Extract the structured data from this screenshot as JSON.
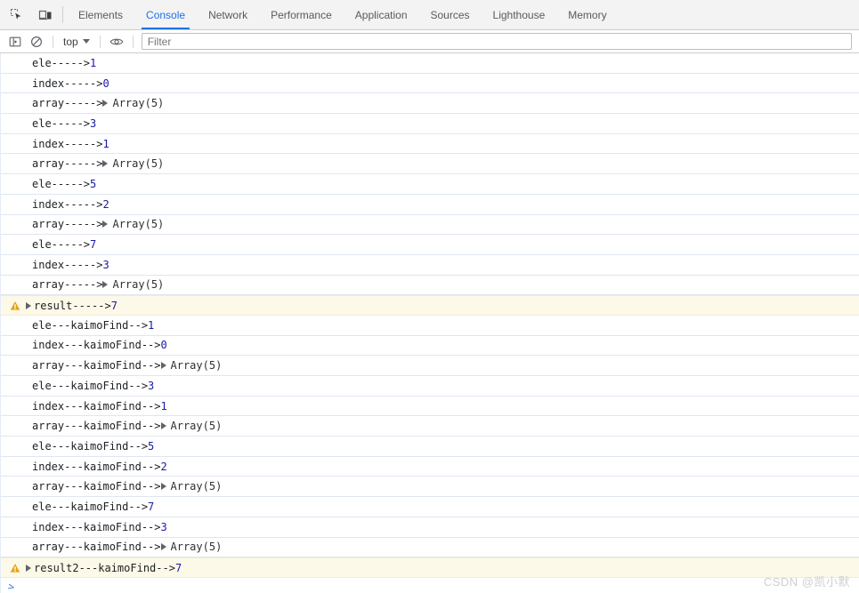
{
  "devtools": {
    "toolbar_icons": [
      {
        "name": "inspect-element-icon",
        "title": "Inspect element"
      },
      {
        "name": "device-toolbar-icon",
        "title": "Toggle device toolbar"
      }
    ],
    "tabs": [
      {
        "label": "Elements",
        "active": false
      },
      {
        "label": "Console",
        "active": true
      },
      {
        "label": "Network",
        "active": false
      },
      {
        "label": "Performance",
        "active": false
      },
      {
        "label": "Application",
        "active": false
      },
      {
        "label": "Sources",
        "active": false
      },
      {
        "label": "Lighthouse",
        "active": false
      },
      {
        "label": "Memory",
        "active": false
      }
    ]
  },
  "console_toolbar": {
    "sidebar_toggle": "show-console-sidebar-icon",
    "clear_console": "clear-console-icon",
    "context_selector": "top",
    "eye_icon": "live-expression-eye-icon",
    "filter_placeholder": "Filter",
    "filter_value": ""
  },
  "messages": [
    {
      "level": "log",
      "label": "ele----->",
      "value": "1",
      "type": "number"
    },
    {
      "level": "log",
      "label": "index----->",
      "value": "0",
      "type": "number"
    },
    {
      "level": "log",
      "label": "array----->",
      "value": "Array(5)",
      "type": "object"
    },
    {
      "level": "log",
      "label": "ele----->",
      "value": "3",
      "type": "number"
    },
    {
      "level": "log",
      "label": "index----->",
      "value": "1",
      "type": "number"
    },
    {
      "level": "log",
      "label": "array----->",
      "value": "Array(5)",
      "type": "object"
    },
    {
      "level": "log",
      "label": "ele----->",
      "value": "5",
      "type": "number"
    },
    {
      "level": "log",
      "label": "index----->",
      "value": "2",
      "type": "number"
    },
    {
      "level": "log",
      "label": "array----->",
      "value": "Array(5)",
      "type": "object"
    },
    {
      "level": "log",
      "label": "ele----->",
      "value": "7",
      "type": "number"
    },
    {
      "level": "log",
      "label": "index----->",
      "value": "3",
      "type": "number"
    },
    {
      "level": "log",
      "label": "array----->",
      "value": "Array(5)",
      "type": "object"
    },
    {
      "level": "warning",
      "label": "result----->",
      "value": "7",
      "type": "number"
    },
    {
      "level": "log",
      "label": "ele---kaimoFind-->",
      "value": "1",
      "type": "number"
    },
    {
      "level": "log",
      "label": "index---kaimoFind-->",
      "value": "0",
      "type": "number"
    },
    {
      "level": "log",
      "label": "array---kaimoFind-->",
      "value": "Array(5)",
      "type": "object"
    },
    {
      "level": "log",
      "label": "ele---kaimoFind-->",
      "value": "3",
      "type": "number"
    },
    {
      "level": "log",
      "label": "index---kaimoFind-->",
      "value": "1",
      "type": "number"
    },
    {
      "level": "log",
      "label": "array---kaimoFind-->",
      "value": "Array(5)",
      "type": "object"
    },
    {
      "level": "log",
      "label": "ele---kaimoFind-->",
      "value": "5",
      "type": "number"
    },
    {
      "level": "log",
      "label": "index---kaimoFind-->",
      "value": "2",
      "type": "number"
    },
    {
      "level": "log",
      "label": "array---kaimoFind-->",
      "value": "Array(5)",
      "type": "object"
    },
    {
      "level": "log",
      "label": "ele---kaimoFind-->",
      "value": "7",
      "type": "number"
    },
    {
      "level": "log",
      "label": "index---kaimoFind-->",
      "value": "3",
      "type": "number"
    },
    {
      "level": "log",
      "label": "array---kaimoFind-->",
      "value": "Array(5)",
      "type": "object"
    },
    {
      "level": "warning",
      "label": "result2---kaimoFind-->",
      "value": "7",
      "type": "number"
    }
  ],
  "prompt": {
    "chevron": ">",
    "value": ""
  },
  "watermark": "CSDN @凯小默",
  "colors": {
    "accent": "#1a73e8",
    "number": "#1a1aa6",
    "warning_bg": "#fdf9e8",
    "warning_icon": "#e8a317",
    "tabbar_bg": "#f3f3f3"
  }
}
